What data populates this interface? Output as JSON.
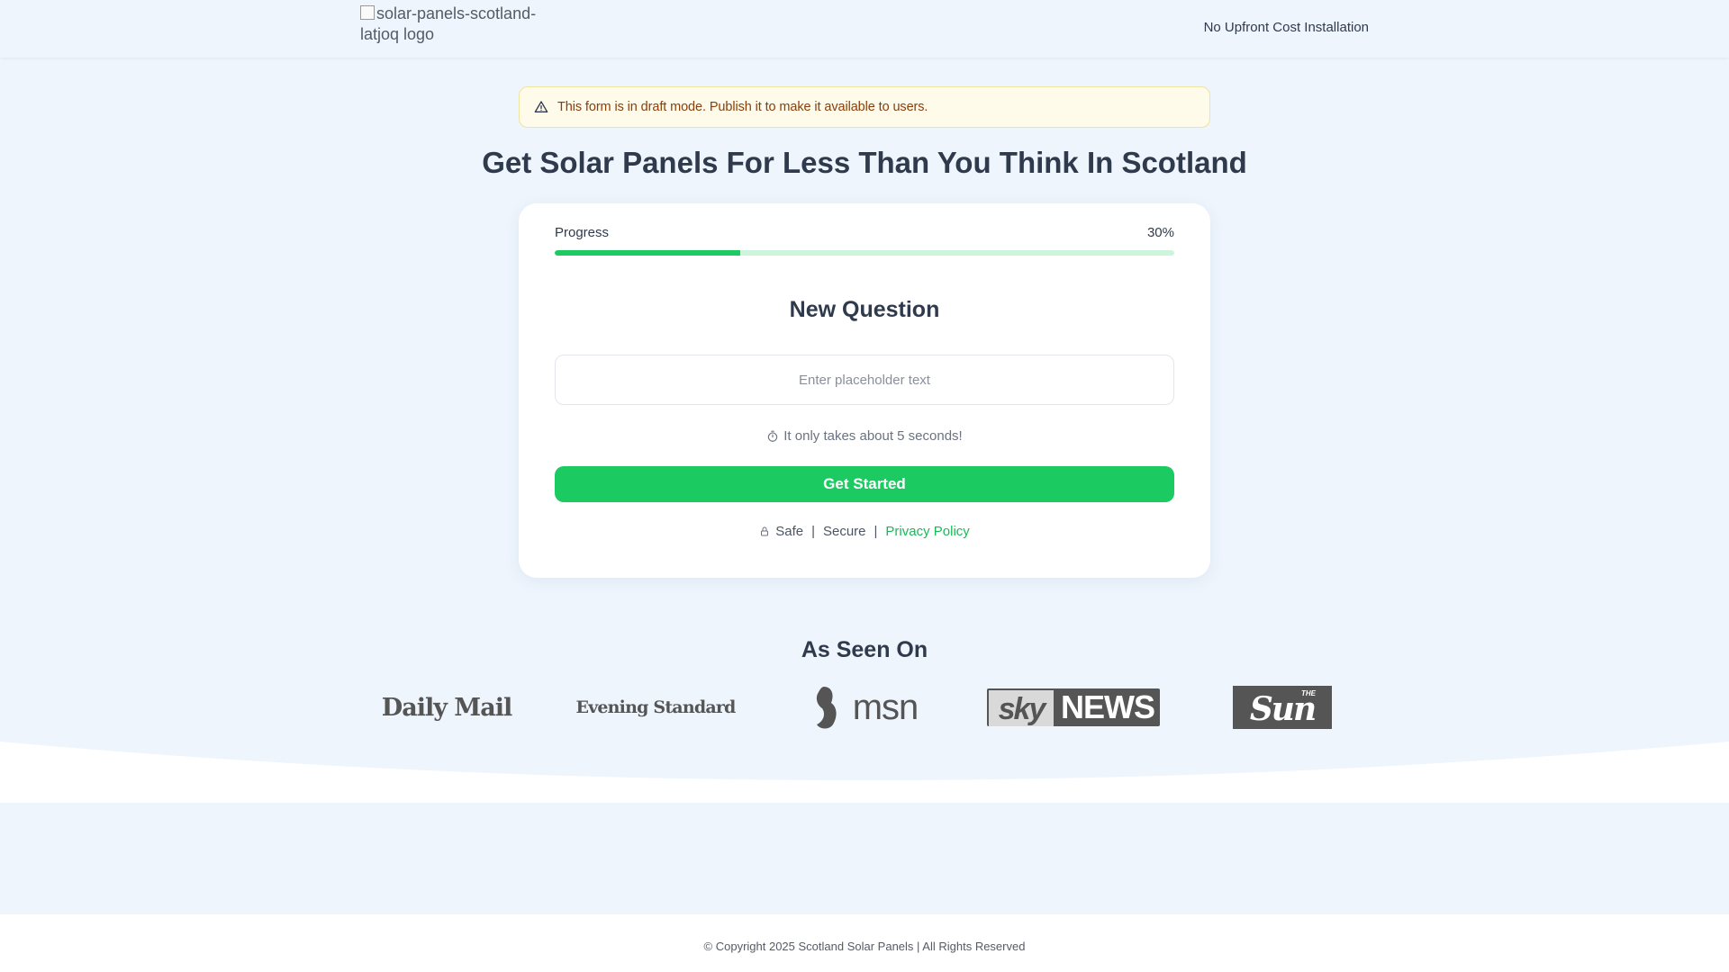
{
  "header": {
    "logo_alt": "solar-panels-scotland-latjoq logo",
    "tagline": "No Upfront Cost Installation"
  },
  "alert": {
    "text": "This form is in draft mode. Publish it to make it available to users.",
    "icon": "warning-triangle-icon"
  },
  "page": {
    "title": "Get Solar Panels For Less Than You Think In Scotland"
  },
  "form": {
    "progress_label": "Progress",
    "progress_percent_text": "30%",
    "progress_value": 0.3,
    "question": "New Question",
    "input_placeholder": "Enter placeholder text",
    "input_value": "",
    "timer_text": "It only takes about 5 seconds!",
    "cta_label": "Get Started",
    "trust": {
      "safe": "Safe",
      "secure": "Secure",
      "separator": "|",
      "privacy_link": "Privacy Policy"
    }
  },
  "press": {
    "title": "As Seen On",
    "logos": {
      "daily_mail": "Daily Mail",
      "evening_standard": "Evening Standard",
      "msn": "msn",
      "sky_news_sky": "sky",
      "sky_news_news": "NEWS",
      "the_sun": "Sun",
      "the_sun_the": "THE"
    }
  },
  "footer": {
    "copyright": "© Copyright 2025 Scotland Solar Panels | All Rights Reserved"
  },
  "colors": {
    "accent": "#1bcb62",
    "background": "#eef5fd",
    "alert_bg": "#fefbea",
    "alert_text": "#8a3e0a",
    "text": "#2f3a4c"
  }
}
